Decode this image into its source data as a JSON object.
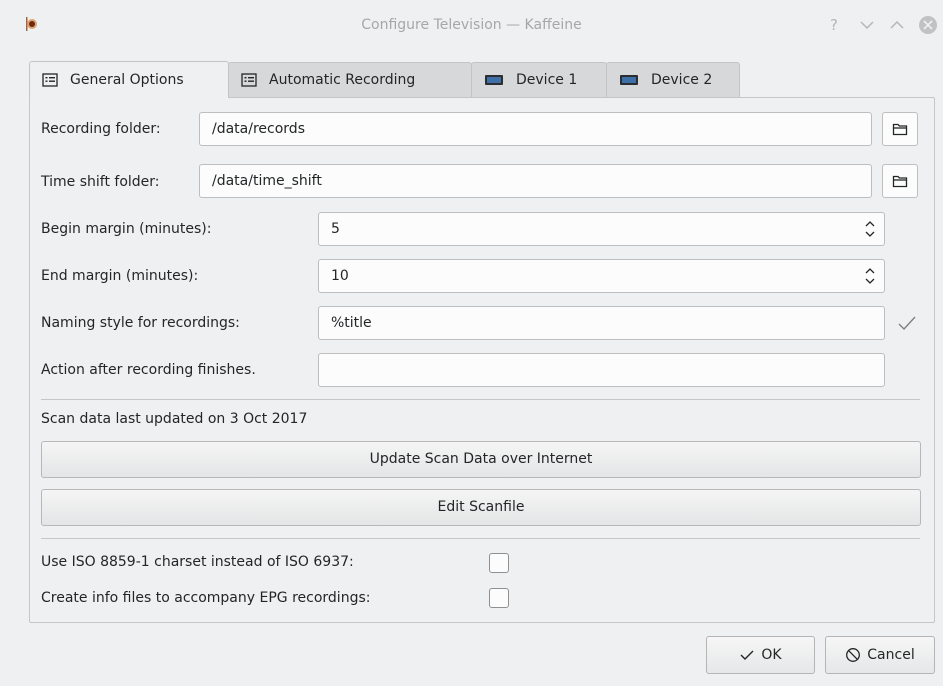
{
  "window": {
    "title": "Configure Television — Kaffeine"
  },
  "tabs": [
    {
      "label": "General Options",
      "icon": "form-icon"
    },
    {
      "label": "Automatic Recording",
      "icon": "form-icon"
    },
    {
      "label": "Device 1",
      "icon": "tv-card-icon"
    },
    {
      "label": "Device 2",
      "icon": "tv-card-icon"
    }
  ],
  "general": {
    "recording_folder_label": "Recording folder:",
    "recording_folder_value": "/data/records",
    "time_shift_label": "Time shift folder:",
    "time_shift_value": "/data/time_shift",
    "begin_margin_label": "Begin margin (minutes):",
    "begin_margin_value": "5",
    "end_margin_label": "End margin (minutes):",
    "end_margin_value": "10",
    "naming_style_label": "Naming style for recordings:",
    "naming_style_value": "%title",
    "action_label": "Action after recording finishes.",
    "action_value": "",
    "scan_updated_text": "Scan data last updated on 3 Oct 2017",
    "update_scan_button": "Update Scan Data over Internet",
    "edit_scanfile_button": "Edit Scanfile",
    "iso_charset_label": "Use ISO 8859-1 charset instead of ISO 6937:",
    "iso_charset_checked": false,
    "info_files_label": "Create info files to accompany EPG recordings:",
    "info_files_checked": false
  },
  "buttons": {
    "ok": "OK",
    "cancel": "Cancel"
  }
}
